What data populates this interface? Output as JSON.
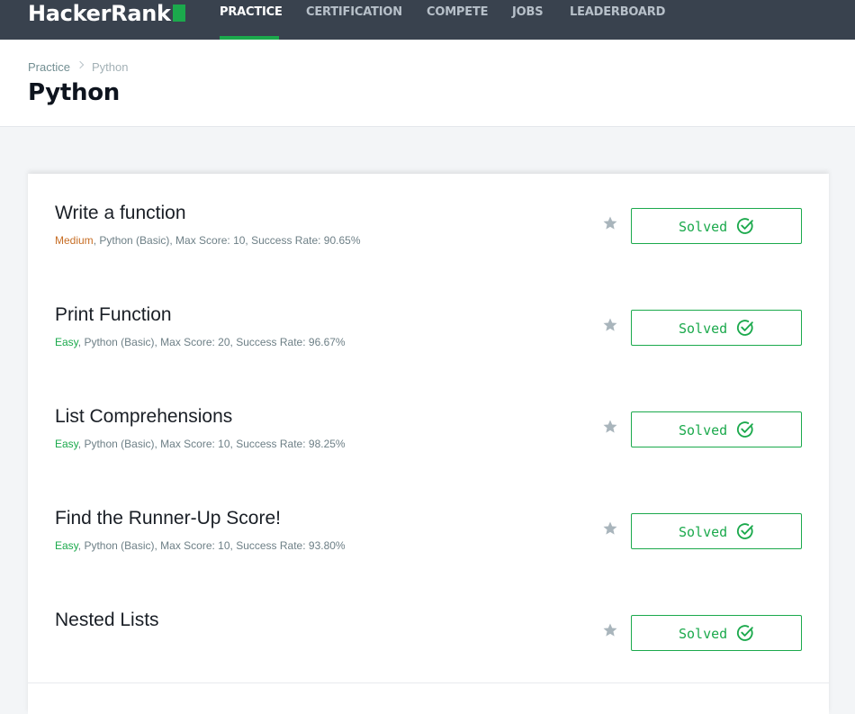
{
  "nav": {
    "logo": "HackerRank",
    "items": [
      "PRACTICE",
      "CERTIFICATION",
      "COMPETE",
      "JOBS",
      "LEADERBOARD"
    ],
    "active": "PRACTICE"
  },
  "breadcrumb": [
    "Practice",
    "Python"
  ],
  "page_title": "Python",
  "challenges": [
    {
      "title": "Write a function",
      "difficulty": "Medium",
      "details": ", Python (Basic), Max Score: 10, Success Rate: 90.65%",
      "status": "Solved"
    },
    {
      "title": "Print Function",
      "difficulty": "Easy",
      "details": ", Python (Basic), Max Score: 20, Success Rate: 96.67%",
      "status": "Solved"
    },
    {
      "title": "List Comprehensions",
      "difficulty": "Easy",
      "details": ", Python (Basic), Max Score: 10, Success Rate: 98.25%",
      "status": "Solved"
    },
    {
      "title": "Find the Runner-Up Score!",
      "difficulty": "Easy",
      "details": ", Python (Basic), Max Score: 10, Success Rate: 93.80%",
      "status": "Solved"
    },
    {
      "title": "Nested Lists",
      "status": "Solved"
    }
  ],
  "colors": {
    "accent": "#1ba94c",
    "navbar": "#39424e",
    "medium": "#c76e25"
  }
}
